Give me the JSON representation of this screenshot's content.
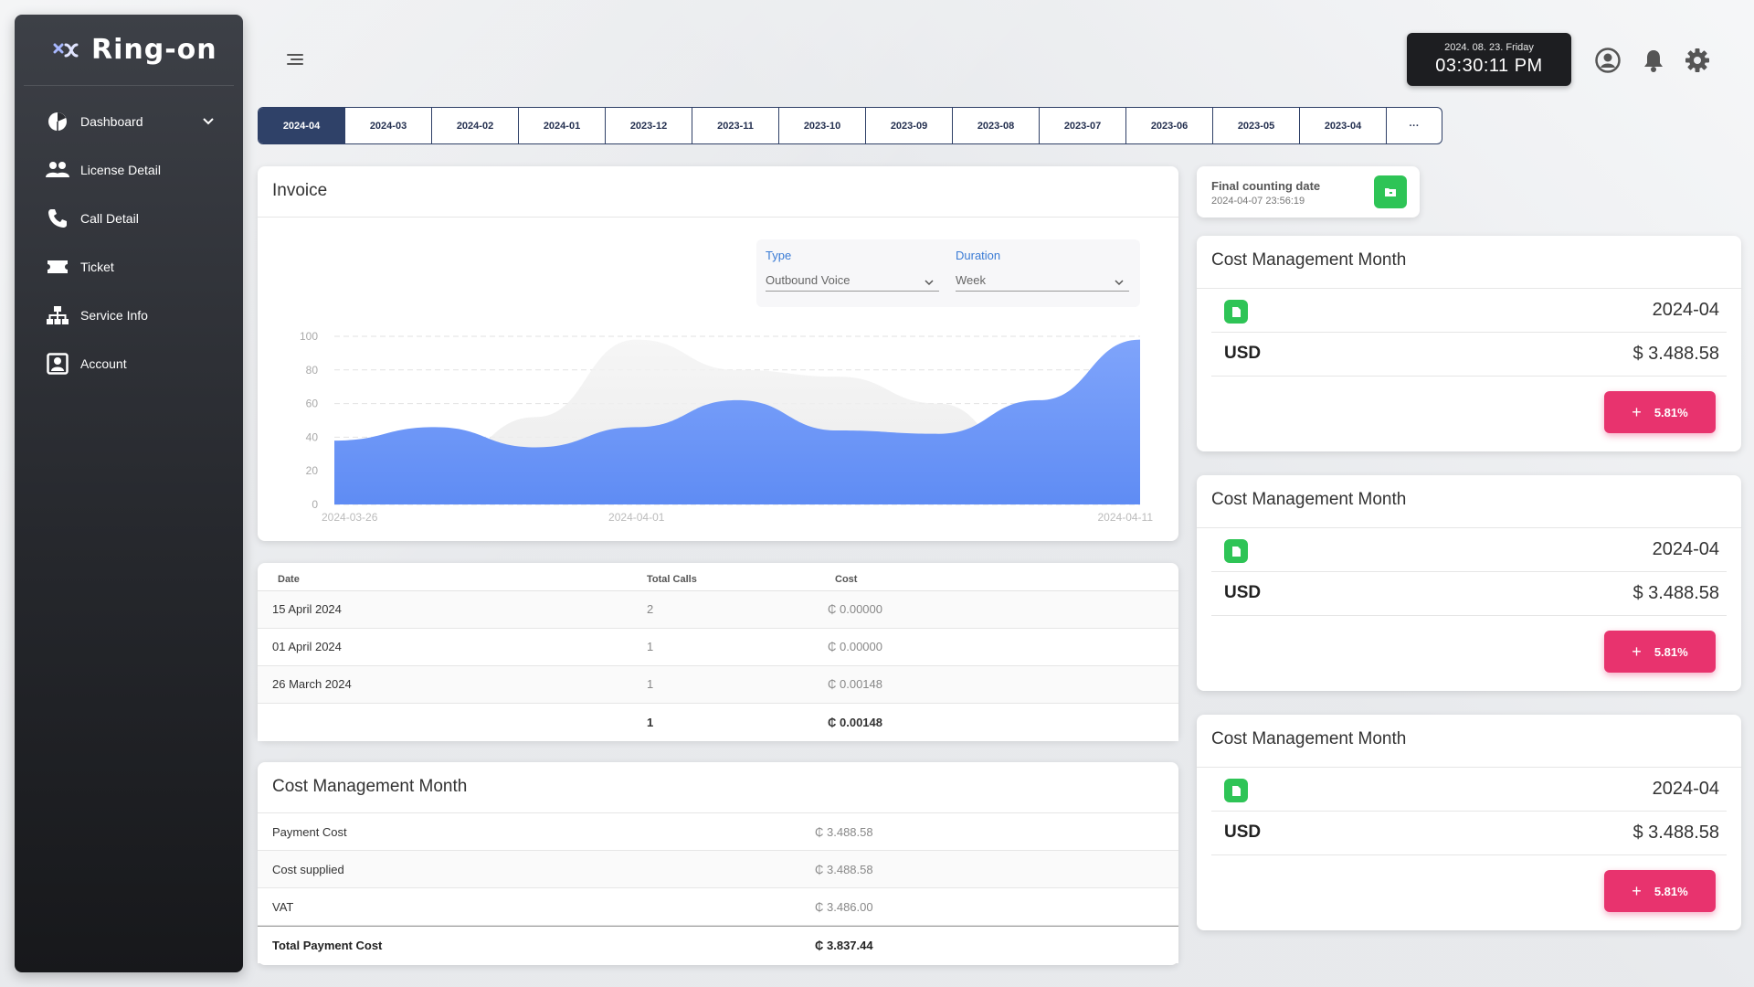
{
  "app": {
    "logo_text": "Ring-on"
  },
  "sidebar": {
    "items": [
      {
        "label": "Dashboard",
        "icon": "pie-chart-icon"
      },
      {
        "label": "License Detail",
        "icon": "users-icon"
      },
      {
        "label": "Call Detail",
        "icon": "phone-icon"
      },
      {
        "label": "Ticket",
        "icon": "ticket-icon"
      },
      {
        "label": "Service Info",
        "icon": "sitemap-icon"
      },
      {
        "label": "Account",
        "icon": "account-box-icon"
      }
    ]
  },
  "header": {
    "clock_date": "2024. 08. 23. Friday",
    "clock_time": "03:30:11 PM"
  },
  "tabs": [
    "2024-04",
    "2024-03",
    "2024-02",
    "2024-01",
    "2023-12",
    "2023-11",
    "2023-10",
    "2023-09",
    "2023-08",
    "2023-07",
    "2023-06",
    "2023-05",
    "2023-04",
    "···"
  ],
  "invoice": {
    "title": "Invoice",
    "type_label": "Type",
    "type_value": "Outbound Voice",
    "duration_label": "Duration",
    "duration_value": "Week"
  },
  "chart_data": {
    "type": "area",
    "x": [
      "2024-03-26",
      "2024-03-28",
      "2024-03-30",
      "2024-04-01",
      "2024-04-03",
      "2024-04-05",
      "2024-04-07",
      "2024-04-09",
      "2024-04-11"
    ],
    "series": [
      {
        "values": [
          38,
          46,
          34,
          46,
          62,
          44,
          42,
          62,
          98
        ],
        "color": "#6f98f7"
      },
      {
        "values": [
          0,
          22,
          52,
          98,
          80,
          76,
          60,
          18,
          0
        ],
        "color": "#ececec"
      }
    ],
    "xticks": [
      "2024-03-26",
      "2024-04-01",
      "2024-04-11"
    ],
    "yticks": [
      "100",
      "80",
      "60",
      "40",
      "20",
      "0"
    ],
    "ylim": [
      0,
      100
    ]
  },
  "calls_table": {
    "headers": [
      "Date",
      "Total Calls",
      "Cost"
    ],
    "rows": [
      [
        "15 April 2024",
        "2",
        "₵ 0.00000"
      ],
      [
        "01 April 2024",
        "1",
        "₵ 0.00000"
      ],
      [
        "26 March 2024",
        "1",
        "₵ 0.00148"
      ]
    ],
    "total": [
      "",
      "1",
      "₵ 0.00148"
    ]
  },
  "cost_month": {
    "title": "Cost Management Month",
    "rows": [
      [
        "Payment Cost",
        "₵ 3.488.58"
      ],
      [
        "Cost supplied",
        "₵ 3.488.58"
      ],
      [
        "VAT",
        "₵ 3.486.00"
      ]
    ],
    "total": [
      "Total Payment Cost",
      "₵ 3.837.44"
    ]
  },
  "final_counting": {
    "label": "Final counting date",
    "value": "2024-04-07 23:56:19"
  },
  "right_cards": [
    {
      "title": "Cost Management Month",
      "month": "2024-04",
      "currency": "USD",
      "amount": "$ 3.488.58",
      "badge": "5.81%"
    },
    {
      "title": "Cost Management Month",
      "month": "2024-04",
      "currency": "USD",
      "amount": "$ 3.488.58",
      "badge": "5.81%"
    },
    {
      "title": "Cost Management Month",
      "month": "2024-04",
      "currency": "USD",
      "amount": "$ 3.488.58",
      "badge": "5.81%"
    }
  ],
  "colors": {
    "accent_navy": "#2f4168",
    "green": "#2ec456",
    "pink": "#e8336e",
    "chart_blue": "#6f98f7"
  }
}
